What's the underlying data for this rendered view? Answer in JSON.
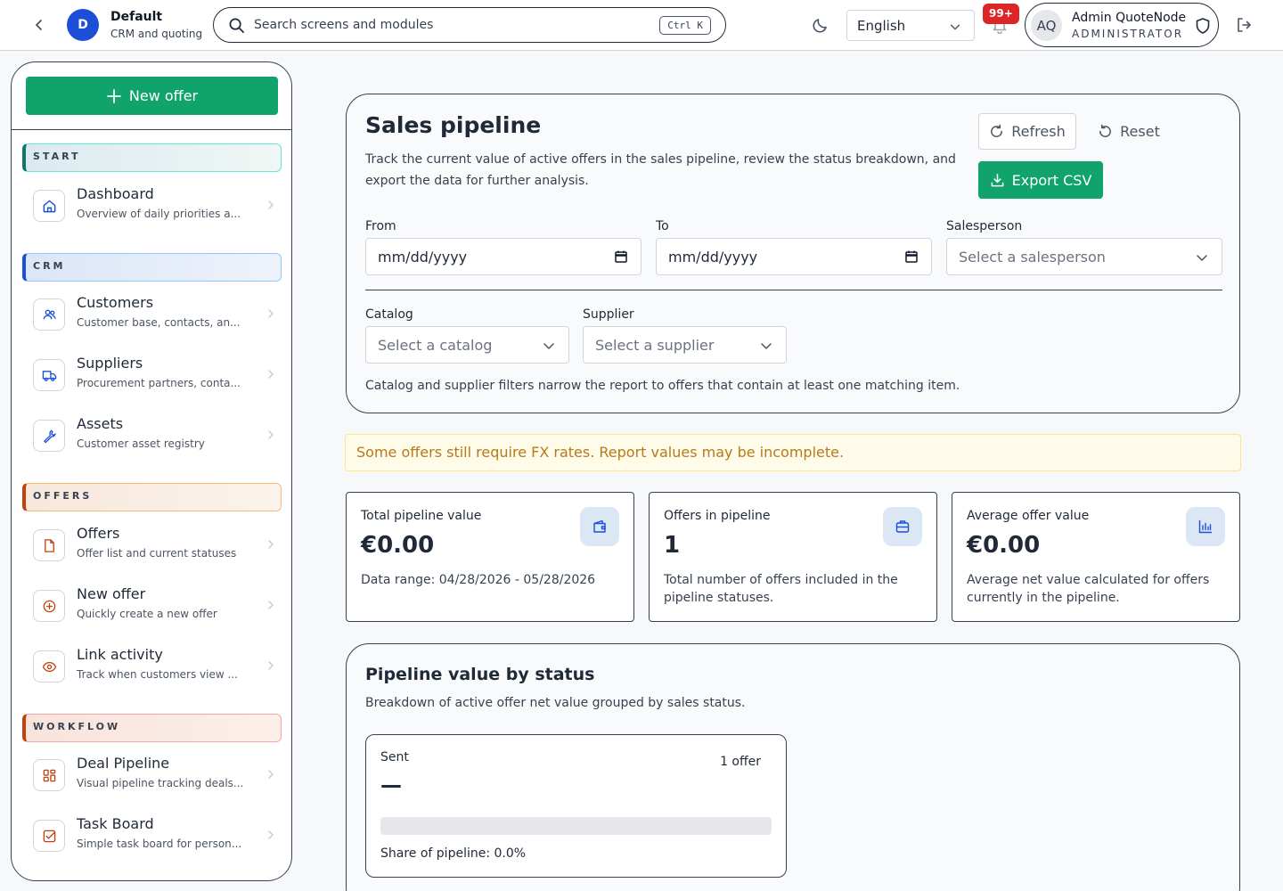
{
  "topbar": {
    "org_initial": "D",
    "org_name": "Default",
    "org_subtitle": "CRM and quoting",
    "search_placeholder": "Search screens and modules",
    "search_shortcut": "Ctrl K",
    "language": "English",
    "notification_count": "99+",
    "user_initials": "AQ",
    "user_name": "Admin QuoteNode",
    "user_role": "ADMINISTRATOR"
  },
  "sidebar": {
    "new_offer_label": "New offer",
    "sections": {
      "start": "START",
      "crm": "CRM",
      "offers": "OFFERS",
      "workflow": "WORKFLOW"
    },
    "items": [
      {
        "title": "Dashboard",
        "subtitle": "Overview of daily priorities a..."
      },
      {
        "title": "Customers",
        "subtitle": "Customer base, contacts, an..."
      },
      {
        "title": "Suppliers",
        "subtitle": "Procurement partners, conta..."
      },
      {
        "title": "Assets",
        "subtitle": "Customer asset registry"
      },
      {
        "title": "Offers",
        "subtitle": "Offer list and current statuses"
      },
      {
        "title": "New offer",
        "subtitle": "Quickly create a new offer"
      },
      {
        "title": "Link activity",
        "subtitle": "Track when customers view ..."
      },
      {
        "title": "Deal Pipeline",
        "subtitle": "Visual pipeline tracking deals..."
      },
      {
        "title": "Task Board",
        "subtitle": "Simple task board for person..."
      }
    ]
  },
  "report": {
    "title": "Sales pipeline",
    "description": "Track the current value of active offers in the sales pipeline, review the status breakdown, and export the data for further analysis.",
    "refresh_label": "Refresh",
    "reset_label": "Reset",
    "export_label": "Export CSV",
    "from_label": "From",
    "from_value": "mm/dd/yyyy",
    "to_label": "To",
    "to_value": "mm/dd/yyyy",
    "salesperson_label": "Salesperson",
    "salesperson_placeholder": "Select a salesperson",
    "catalog_label": "Catalog",
    "catalog_placeholder": "Select a catalog",
    "supplier_label": "Supplier",
    "supplier_placeholder": "Select a supplier",
    "filter_note": "Catalog and supplier filters narrow the report to offers that contain at least one matching item."
  },
  "warning": "Some offers still require FX rates. Report values may be incomplete.",
  "metrics": [
    {
      "title": "Total pipeline value",
      "value": "€0.00",
      "detail": "Data range: 04/28/2026 - 05/28/2026",
      "icon": "wallet-icon"
    },
    {
      "title": "Offers in pipeline",
      "value": "1",
      "detail": "Total number of offers included in the pipeline statuses.",
      "icon": "briefcase-icon"
    },
    {
      "title": "Average offer value",
      "value": "€0.00",
      "detail": "Average net value calculated for offers currently in the pipeline.",
      "icon": "bar-chart-icon"
    }
  ],
  "by_status": {
    "title": "Pipeline value by status",
    "description": "Breakdown of active offer net value grouped by sales status.",
    "statuses": [
      {
        "name": "Sent",
        "count": "1 offer",
        "value": "—",
        "share_fraction": 0.0,
        "share_label": "Share of pipeline: 0.0%"
      }
    ]
  },
  "colors": {
    "accent_green": "#10a36b",
    "brand_blue": "#1d4ed8",
    "warning_text": "#b7791f",
    "badge_red": "#dc2626"
  }
}
